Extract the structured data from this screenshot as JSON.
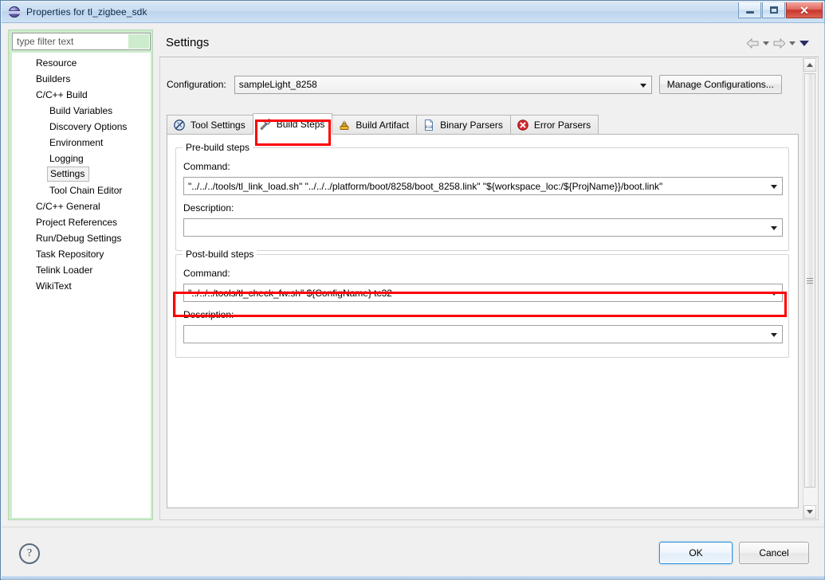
{
  "window": {
    "title": "Properties for tl_zigbee_sdk",
    "icon": "eclipse-globe-icon",
    "controls": {
      "minimize": "minimize-button",
      "maximize": "restore-button",
      "close": "✕"
    }
  },
  "sidebar": {
    "filter_placeholder": "type filter text",
    "filter_value": "",
    "items": [
      {
        "label": "Resource",
        "level": 1,
        "selected": false
      },
      {
        "label": "Builders",
        "level": 1,
        "selected": false
      },
      {
        "label": "C/C++ Build",
        "level": 1,
        "selected": false
      },
      {
        "label": "Build Variables",
        "level": 2,
        "selected": false
      },
      {
        "label": "Discovery Options",
        "level": 2,
        "selected": false
      },
      {
        "label": "Environment",
        "level": 2,
        "selected": false
      },
      {
        "label": "Logging",
        "level": 2,
        "selected": false
      },
      {
        "label": "Settings",
        "level": 2,
        "selected": true
      },
      {
        "label": "Tool Chain Editor",
        "level": 2,
        "selected": false
      },
      {
        "label": "C/C++ General",
        "level": 1,
        "selected": false
      },
      {
        "label": "Project References",
        "level": 1,
        "selected": false
      },
      {
        "label": "Run/Debug Settings",
        "level": 1,
        "selected": false
      },
      {
        "label": "Task Repository",
        "level": 1,
        "selected": false
      },
      {
        "label": "Telink Loader",
        "level": 1,
        "selected": false
      },
      {
        "label": "WikiText",
        "level": 1,
        "selected": false
      }
    ]
  },
  "page": {
    "title": "Settings",
    "nav": {
      "back": "back-arrow-icon",
      "back_menu": "chevron-down-icon",
      "forward": "forward-arrow-icon",
      "forward_menu": "chevron-down-icon",
      "view_menu": "view-menu-chevron-icon"
    }
  },
  "configuration": {
    "label": "Configuration:",
    "value": "sampleLight_8258",
    "manage_button": "Manage Configurations..."
  },
  "tabs": [
    {
      "label": "Tool Settings",
      "icon": "tool-settings-icon",
      "active": false
    },
    {
      "label": "Build Steps",
      "icon": "build-steps-hammer-icon",
      "active": true
    },
    {
      "label": "Build Artifact",
      "icon": "build-artifact-icon",
      "active": false
    },
    {
      "label": "Binary Parsers",
      "icon": "binary-parsers-icon",
      "active": false
    },
    {
      "label": "Error Parsers",
      "icon": "error-parsers-icon",
      "active": false
    }
  ],
  "prebuild": {
    "group_title": "Pre-build steps",
    "command_label": "Command:",
    "command_value": "\"../../../tools/tl_link_load.sh\" \"../../../platform/boot/8258/boot_8258.link\" \"${workspace_loc:/${ProjName}}/boot.link\"",
    "description_label": "Description:",
    "description_value": ""
  },
  "postbuild": {
    "group_title": "Post-build steps",
    "command_label": "Command:",
    "command_value": "\"../../../tools/tl_check_fw.sh\" ${ConfigName} tc32",
    "description_label": "Description:",
    "description_value": ""
  },
  "footer": {
    "help": "?",
    "ok": "OK",
    "cancel": "Cancel"
  },
  "colors": {
    "annotation": "#ff0000",
    "sidebar_background": "#cdeccd",
    "title_bar": "#c9ddf2",
    "close_button": "#c9352a"
  }
}
